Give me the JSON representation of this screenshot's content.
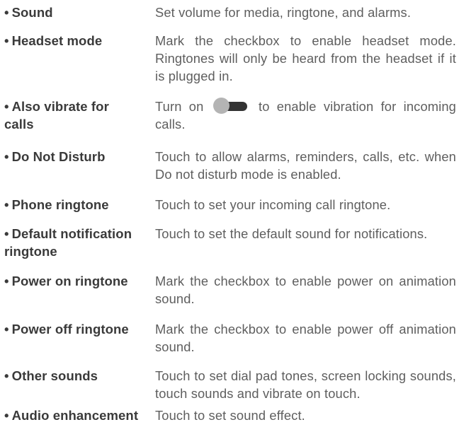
{
  "bullet": "•",
  "settings": [
    {
      "term": "Sound",
      "description": "Set volume for media, ringtone, and alarms."
    },
    {
      "term": "Headset mode",
      "description": "Mark the checkbox to enable headset mode. Ringtones will only be heard from the headset if it is plugged in."
    },
    {
      "term": "Also vibrate for calls",
      "description_before": "Turn on",
      "toggle_icon": "toggle-switch-icon",
      "description_after": "to enable vibration for incoming calls."
    },
    {
      "term": "Do Not Disturb",
      "description": "Touch to allow alarms, reminders, calls, etc. when Do not disturb mode is enabled."
    },
    {
      "term": "Phone ringtone",
      "description": "Touch to set your incoming call ringtone."
    },
    {
      "term": "Default notification ringtone",
      "description": "Touch to set the default sound for notifications."
    },
    {
      "term": "Power on ringtone",
      "description": "Mark the checkbox to enable power on animation sound."
    },
    {
      "term": "Power off ringtone",
      "description": "Mark the checkbox to enable power off animation sound."
    },
    {
      "term": "Other sounds",
      "description": "Touch to set dial pad tones, screen locking sounds, touch sounds and vibrate on touch."
    },
    {
      "term": "Audio enhancement",
      "description": "Touch to set sound effect."
    }
  ],
  "colors": {
    "term_text": "#3a3a3a",
    "description_text": "#5e5e5e",
    "toggle_track": "#333333",
    "toggle_knob": "#b4b4b4"
  }
}
